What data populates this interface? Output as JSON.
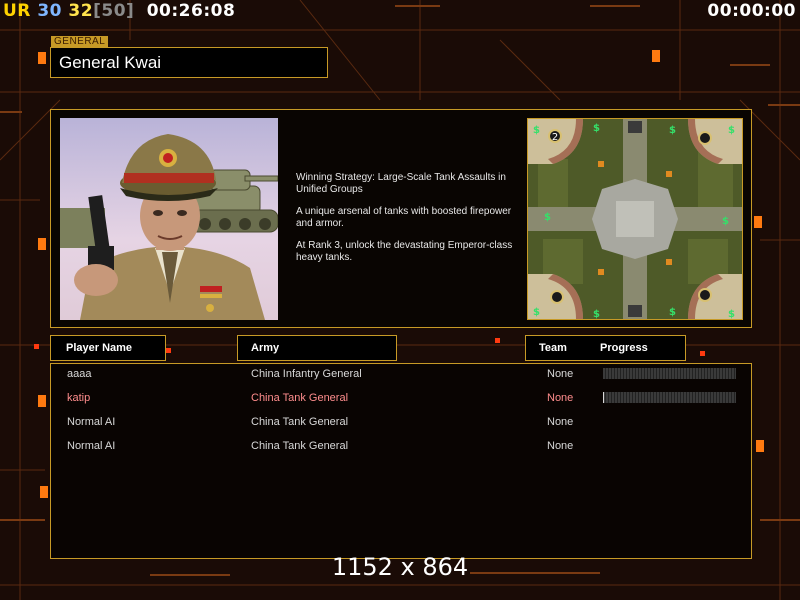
{
  "hud": {
    "ur": "UR",
    "stat1": "30",
    "stat2": "32",
    "stat3": "[50]",
    "elapsed": "00:26:08",
    "timer_right": "00:00:00"
  },
  "general": {
    "tag": "GENERAL",
    "name": "General Kwai",
    "description": [
      "Winning Strategy: Large-Scale Tank Assaults in Unified Groups",
      "A unique arsenal of tanks with boosted firepower and armor.",
      "At Rank 3, unlock the devastating Emperor-class heavy tanks."
    ]
  },
  "map": {
    "start_marker": "2",
    "supply_label": "$"
  },
  "columns": {
    "player": "Player Name",
    "army": "Army",
    "team": "Team",
    "progress": "Progress"
  },
  "players": [
    {
      "name": "aaaa",
      "army": "China Infantry General",
      "team": "None",
      "progress": 0.0,
      "has_progress": true,
      "local": false
    },
    {
      "name": "katip",
      "army": "China Tank General",
      "team": "None",
      "progress": 0.01,
      "has_progress": true,
      "local": true
    },
    {
      "name": "Normal AI",
      "army": "China Tank General",
      "team": "None",
      "has_progress": false,
      "local": false
    },
    {
      "name": "Normal AI",
      "army": "China Tank General",
      "team": "None",
      "has_progress": false,
      "local": false
    }
  ],
  "resolution": "1152 x 864",
  "colors": {
    "accent": "#c79a26",
    "background": "#1a0b06",
    "local_player": "#ff8d8d"
  }
}
